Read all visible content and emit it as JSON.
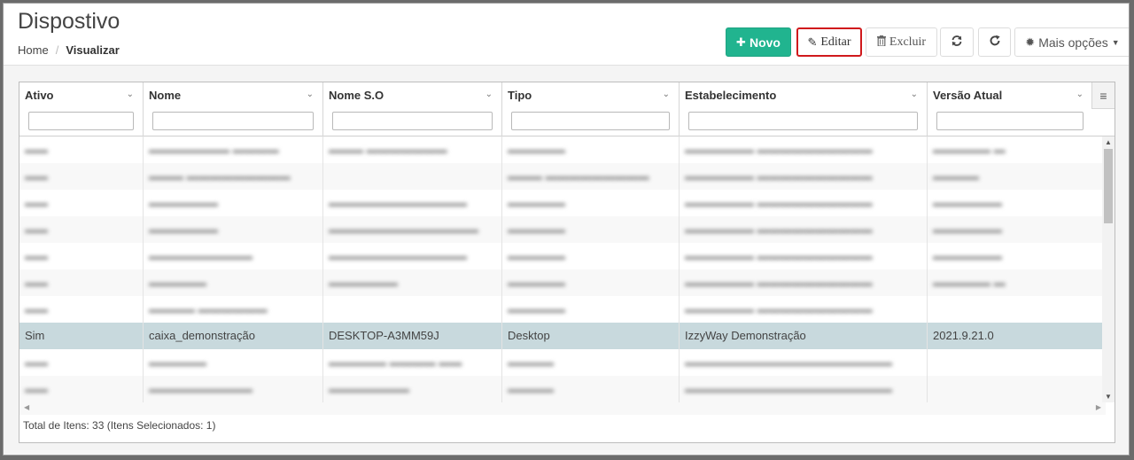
{
  "page": {
    "title": "Dispostivo"
  },
  "breadcrumb": {
    "home": "Home",
    "separator": "/",
    "current": "Visualizar"
  },
  "toolbar": {
    "novo": "Novo",
    "editar": "Editar",
    "excluir": "Excluir",
    "mais": "Mais opções"
  },
  "columns": [
    "Ativo",
    "Nome",
    "Nome S.O",
    "Tipo",
    "Estabelecimento",
    "Versão Atual"
  ],
  "rows": [
    [
      "Sim",
      "caixa_demonstração",
      "DESKTOP-A3MM59J",
      "Desktop",
      "IzzyWay Demonstração",
      "2021.9.21.0"
    ]
  ],
  "footer": {
    "summary": "Total de Itens: 33 (Itens Selecionados: 1)"
  },
  "colors": {
    "accent": "#21b48f",
    "selected_row": "#c8d9dd",
    "highlight_border": "#d0191c"
  }
}
